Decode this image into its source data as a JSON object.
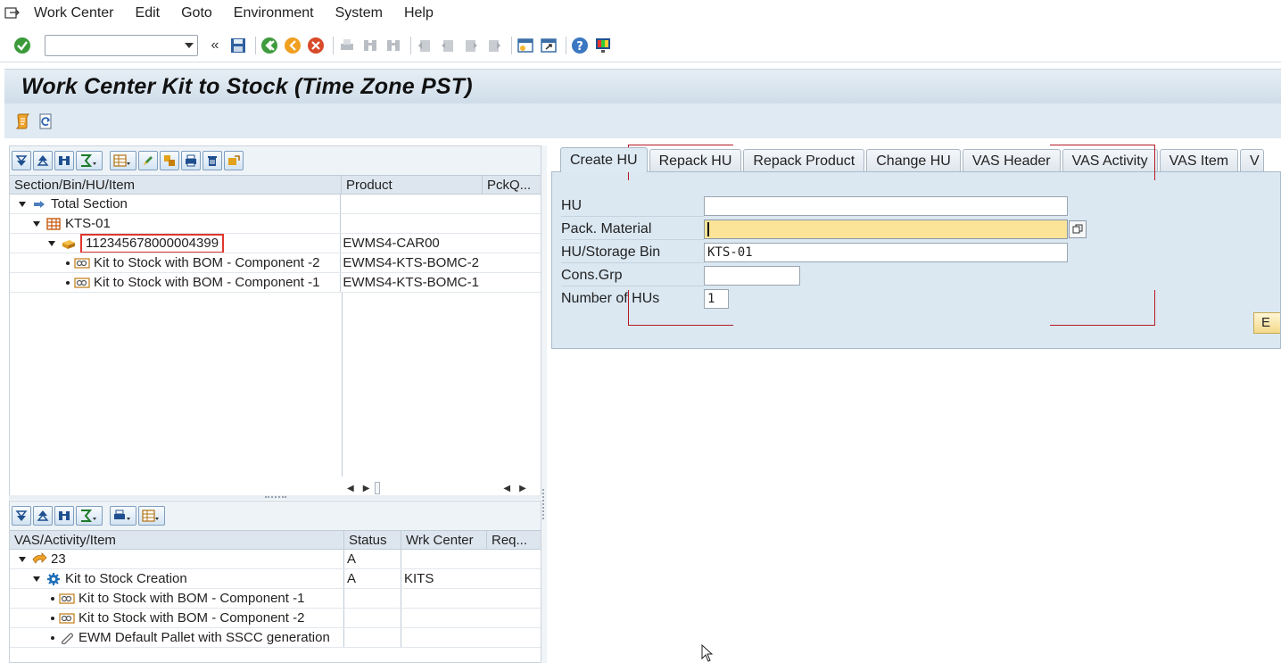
{
  "menu": {
    "items": [
      "Work Center",
      "Edit",
      "Goto",
      "Environment",
      "System",
      "Help"
    ]
  },
  "toolbar": {
    "command_field_value": "",
    "icons": [
      "enter-icon",
      "save-icon",
      "back-icon",
      "exit-icon",
      "cancel-icon",
      "print-icon",
      "find-icon",
      "find-next-icon",
      "first-page-icon",
      "previous-page-icon",
      "next-page-icon",
      "last-page-icon",
      "new-session-icon",
      "shortcut-icon",
      "help-icon",
      "customize-layout-icon"
    ]
  },
  "title": "Work Center Kit to Stock (Time Zone PST)",
  "upper_tree": {
    "columns": [
      "Section/Bin/HU/Item",
      "Product",
      "PckQ..."
    ],
    "rows": [
      {
        "label": "Total Section",
        "product": "",
        "level": 0
      },
      {
        "label": "KTS-01",
        "product": "",
        "level": 1
      },
      {
        "label": "112345678000004399",
        "product": "EWMS4-CAR00",
        "level": 2
      },
      {
        "label": "Kit to Stock with BOM - Component -2",
        "product": "EWMS4-KTS-BOMC-2",
        "level": 3
      },
      {
        "label": "Kit to Stock with BOM - Component -1",
        "product": "EWMS4-KTS-BOMC-1",
        "level": 3
      }
    ]
  },
  "lower_tree": {
    "columns": [
      "VAS/Activity/Item",
      "Status",
      "Wrk Center",
      "Req..."
    ],
    "rows": [
      {
        "label": "23",
        "status": "A",
        "wrk_center": "",
        "level": 0
      },
      {
        "label": "Kit to Stock Creation",
        "status": "A",
        "wrk_center": "KITS",
        "level": 1
      },
      {
        "label": "Kit to Stock with BOM - Component -1",
        "status": "",
        "wrk_center": "",
        "level": 2
      },
      {
        "label": "Kit to Stock with BOM - Component -2",
        "status": "",
        "wrk_center": "",
        "level": 2
      },
      {
        "label": "EWM Default Pallet with SSCC generation",
        "status": "",
        "wrk_center": "",
        "level": 2
      }
    ]
  },
  "tabs": [
    "Create HU",
    "Repack HU",
    "Repack Product",
    "Change HU",
    "VAS Header",
    "VAS Activity",
    "VAS Item",
    "V"
  ],
  "form": {
    "hu_label": "HU",
    "hu_value": "",
    "pack_material_label": "Pack. Material",
    "pack_material_value": "",
    "storage_bin_label": "HU/Storage Bin",
    "storage_bin_value": "KTS-01",
    "cons_grp_label": "Cons.Grp",
    "cons_grp_value": "",
    "num_hus_label": "Number of HUs",
    "num_hus_value": "1",
    "exec_button_label": "E"
  },
  "colors": {
    "accent_blue": "#dbe8f2",
    "focus_yellow": "#fbe398",
    "highlight_red": "#e0362c"
  }
}
